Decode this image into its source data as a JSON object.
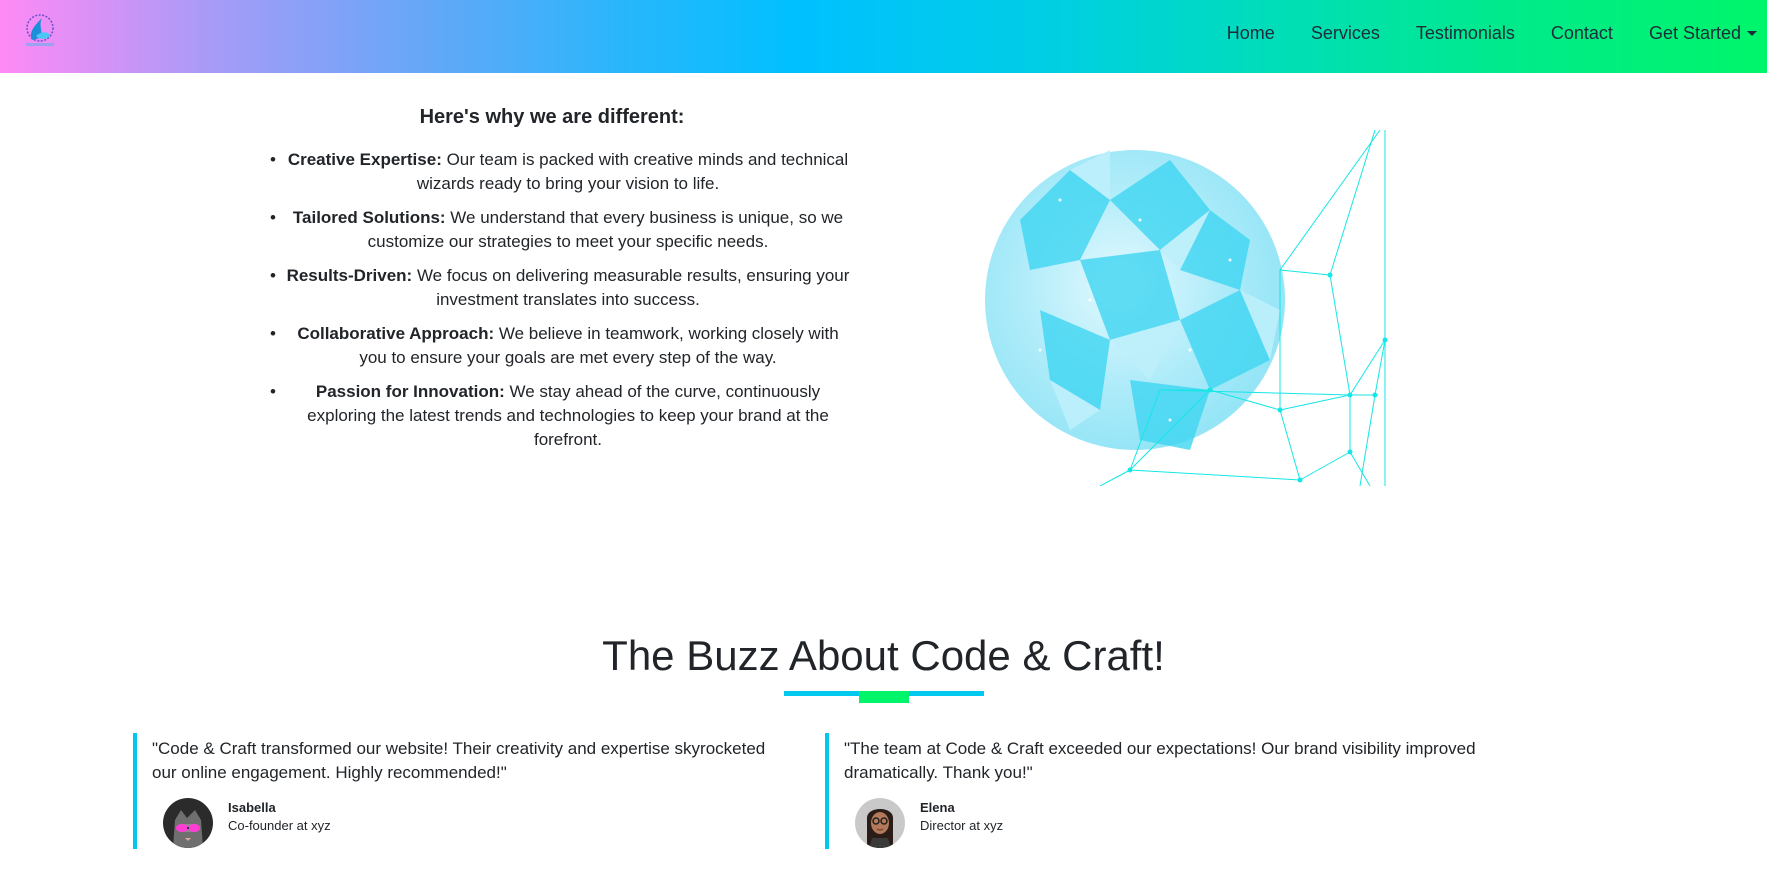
{
  "navbar": {
    "links": [
      "Home",
      "Services",
      "Testimonials",
      "Contact"
    ],
    "dropdown_label": "Get Started",
    "gradient_colors": [
      "#ff8af5",
      "#00c0ff",
      "#00f56a"
    ]
  },
  "why": {
    "title": "Here's why we are different:",
    "items": [
      {
        "bold": "Creative Expertise:",
        "text": " Our team is packed with creative minds and technical wizards ready to bring your vision to life."
      },
      {
        "bold": "Tailored Solutions:",
        "text": " We understand that every business is unique, so we customize our strategies to meet your specific needs."
      },
      {
        "bold": "Results-Driven:",
        "text": " We focus on delivering measurable results, ensuring your investment translates into success."
      },
      {
        "bold": "Collaborative Approach:",
        "text": " We believe in teamwork, working closely with you to ensure your goals are met every step of the way."
      },
      {
        "bold": "Passion for Innovation:",
        "text": " We stay ahead of the curve, continuously exploring the latest trends and technologies to keep your brand at the forefront."
      }
    ],
    "bullet": "•"
  },
  "testimonials": {
    "title": "The Buzz About Code & Craft!",
    "accent_color": "#00c8ef",
    "accent_secondary": "#00f56a",
    "items": [
      {
        "quote": "\"Code & Craft transformed our website! Their creativity and expertise skyrocketed our online engagement. Highly recommended!\"",
        "name": "Isabella",
        "role": "Co-founder at xyz"
      },
      {
        "quote": "\"The team at Code & Craft exceeded our expectations! Our brand visibility improved dramatically. Thank you!\"",
        "name": "Elena",
        "role": "Director at xyz"
      }
    ]
  }
}
